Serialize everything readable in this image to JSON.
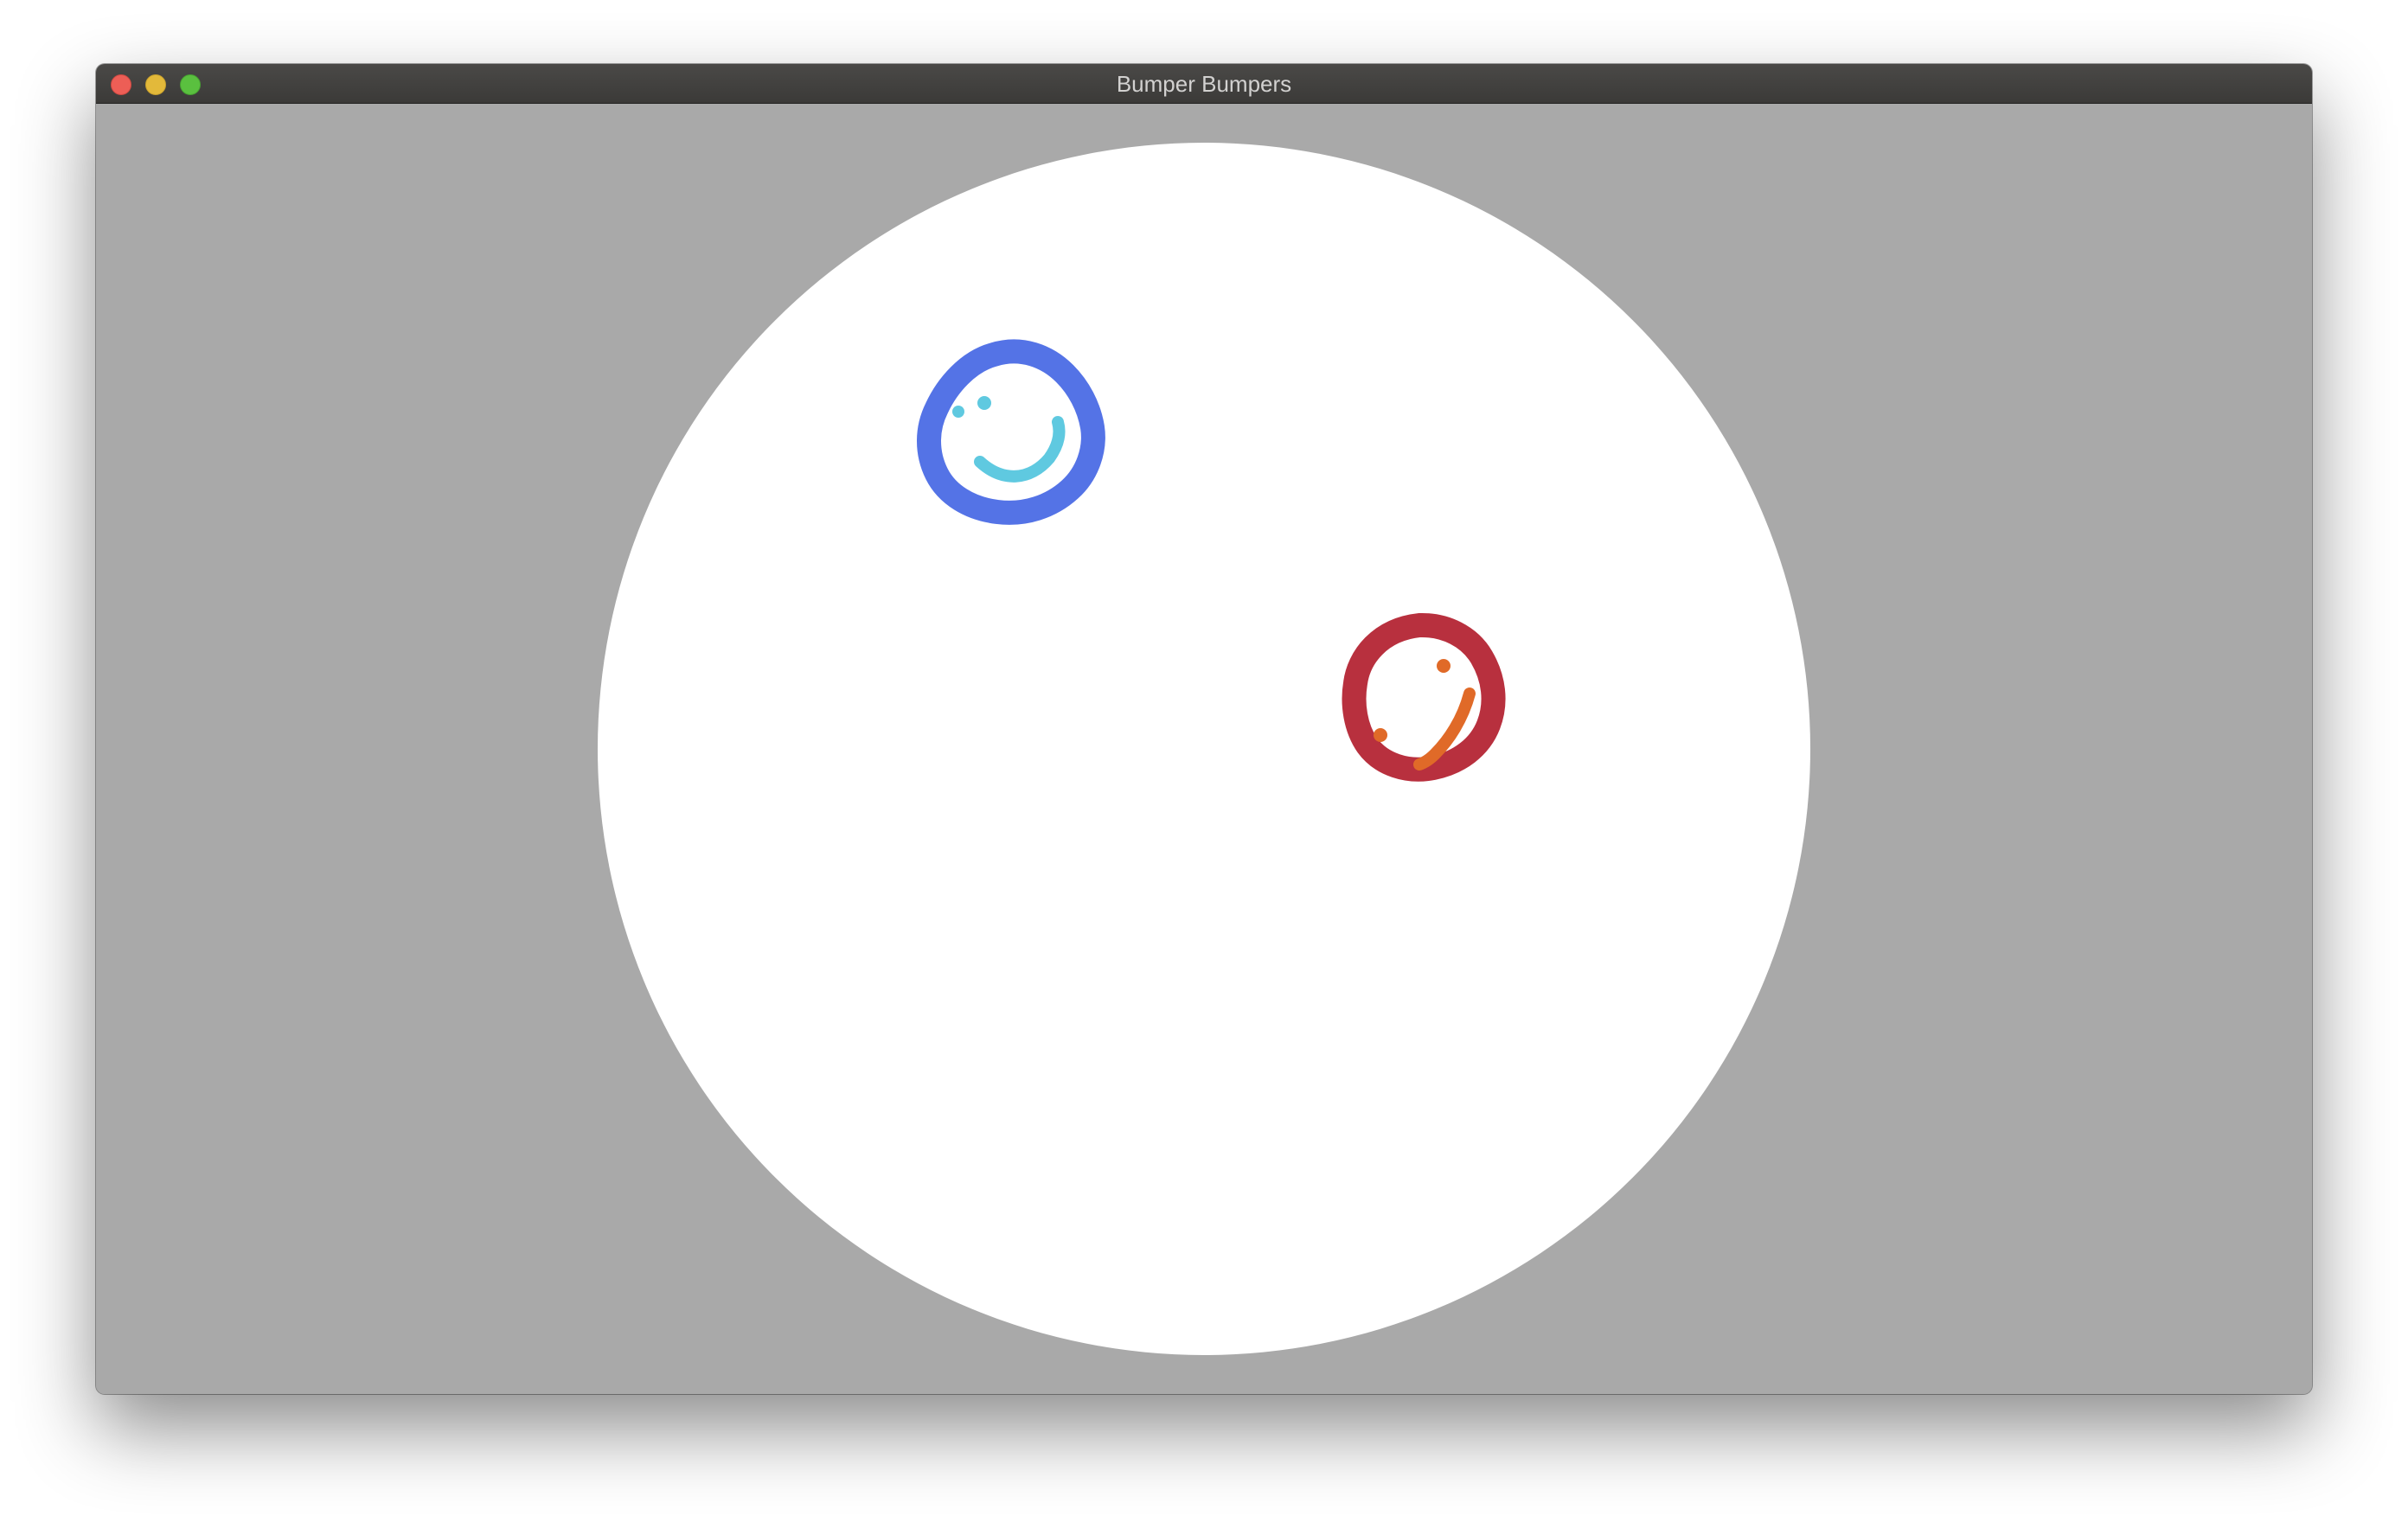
{
  "window": {
    "title": "Bumper Bumpers"
  },
  "colors": {
    "background": "#a9a9a9",
    "arena": "#ffffff",
    "blue_body": "#5473e6",
    "blue_face": "#5fc9e0",
    "red_body": "#b8303e",
    "red_face": "#e06a28"
  },
  "game": {
    "arena": "white-circle",
    "players": [
      {
        "name": "blue-bumper",
        "body_color": "#5473e6",
        "face_color": "#5fc9e0",
        "face": "smile"
      },
      {
        "name": "red-bumper",
        "body_color": "#b8303e",
        "face_color": "#e06a28",
        "face": "smile"
      }
    ]
  }
}
